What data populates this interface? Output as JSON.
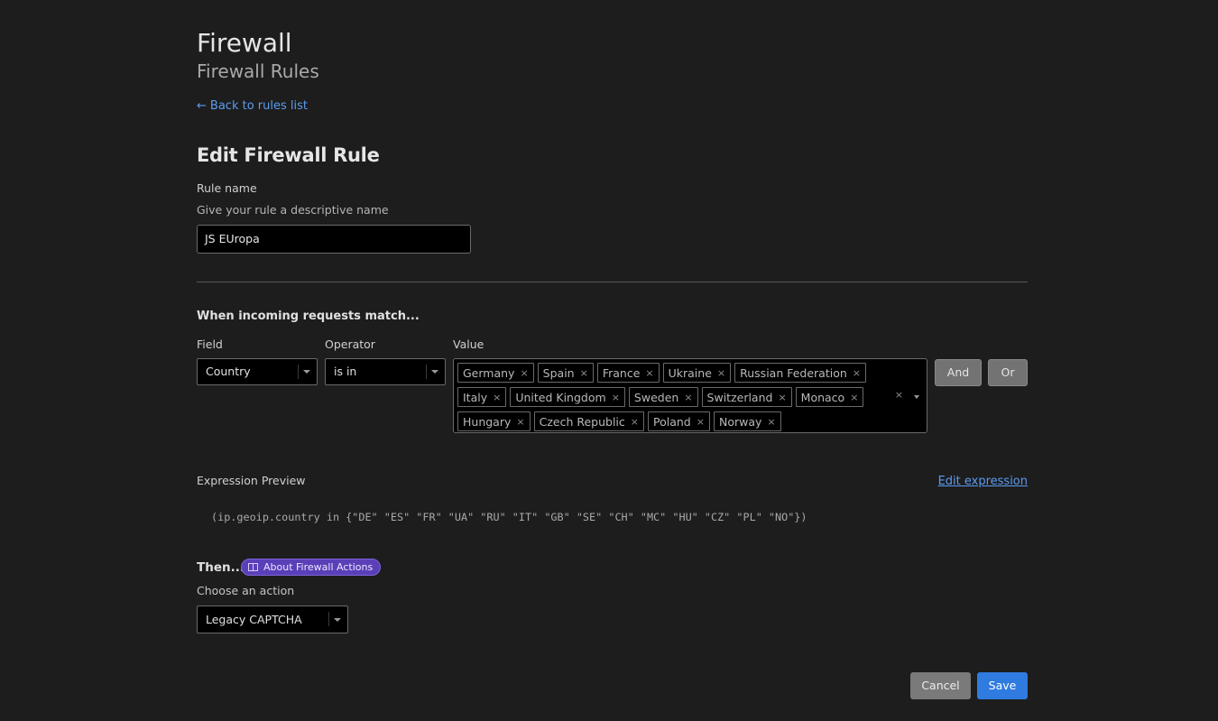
{
  "header": {
    "title": "Firewall",
    "subtitle": "Firewall Rules",
    "back_link": "Back to rules list"
  },
  "form": {
    "heading": "Edit Firewall Rule",
    "rule_name_label": "Rule name",
    "rule_name_hint": "Give your rule a descriptive name",
    "rule_name_value": "JS EUropa"
  },
  "match": {
    "heading": "When incoming requests match...",
    "field_label": "Field",
    "field_value": "Country",
    "operator_label": "Operator",
    "operator_value": "is in",
    "value_label": "Value",
    "values": [
      "Germany",
      "Spain",
      "France",
      "Ukraine",
      "Russian Federation",
      "Italy",
      "United Kingdom",
      "Sweden",
      "Switzerland",
      "Monaco",
      "Hungary",
      "Czech Republic",
      "Poland",
      "Norway"
    ],
    "remove_glyph": "×",
    "clear_glyph": "×",
    "and_label": "And",
    "or_label": "Or"
  },
  "expression": {
    "label": "Expression Preview",
    "edit_link": "Edit expression",
    "text": "(ip.geoip.country in {\"DE\" \"ES\" \"FR\" \"UA\" \"RU\" \"IT\" \"GB\" \"SE\" \"CH\" \"MC\" \"HU\" \"CZ\" \"PL\" \"NO\"})"
  },
  "action": {
    "then_label": "Then...",
    "badge_label": "About Firewall Actions",
    "choose_label": "Choose an action",
    "value": "Legacy CAPTCHA"
  },
  "footer": {
    "cancel_label": "Cancel",
    "save_label": "Save"
  },
  "icons": {
    "back": "arrow-left-icon",
    "book": "book-icon",
    "caret": "chevron-down-icon",
    "remove": "close-icon"
  },
  "colors": {
    "background": "#1d1d1d",
    "link": "#5b9bf0",
    "primary": "#2f7be0",
    "badge": "#5b3fb8"
  }
}
